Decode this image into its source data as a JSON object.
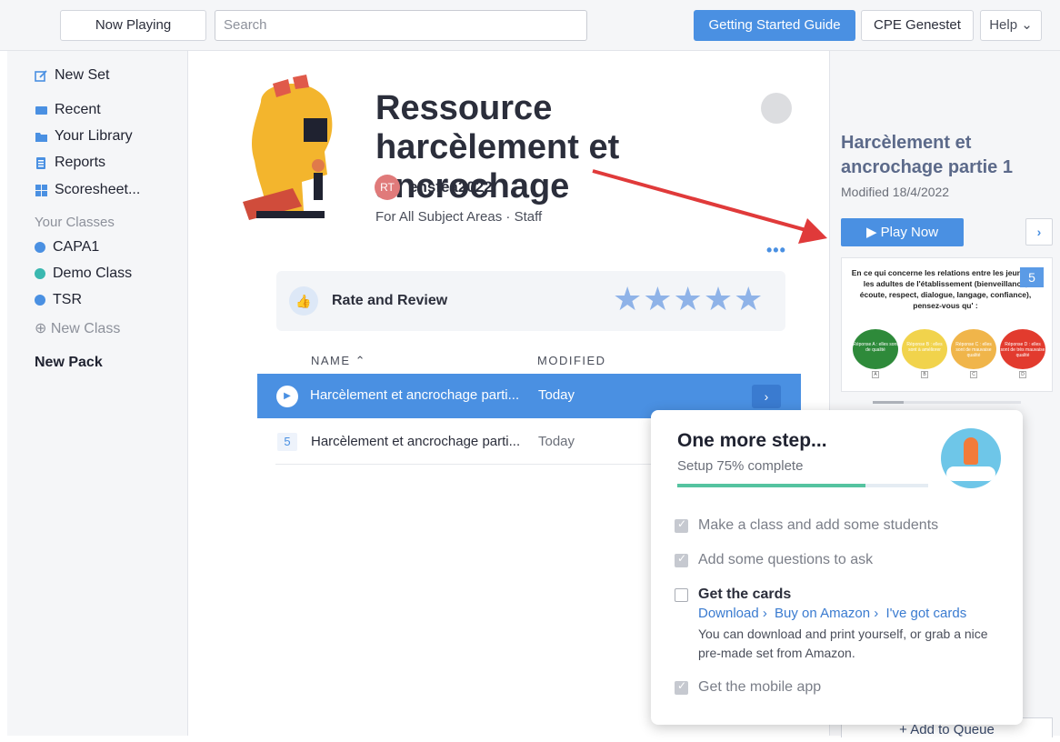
{
  "topbar": {
    "now_playing": "Now Playing",
    "search_placeholder": "Search",
    "guide": "Getting Started Guide",
    "account": "CPE Genestet",
    "help": "Help ⌄"
  },
  "sidebar": {
    "items": [
      {
        "label": "New Set",
        "icon": "edit-icon",
        "color": "#4a90e2"
      },
      {
        "label": "Recent",
        "icon": "recent-icon",
        "color": "#4a90e2"
      },
      {
        "label": "Your Library",
        "icon": "folder-icon",
        "color": "#4a90e2"
      },
      {
        "label": "Reports",
        "icon": "reports-icon",
        "color": "#4a90e2"
      },
      {
        "label": "Scoresheet...",
        "icon": "grid-icon",
        "color": "#4a90e2"
      }
    ],
    "classes_heading": "Your Classes",
    "classes": [
      {
        "label": "CAPA1",
        "color": "#4a90e2"
      },
      {
        "label": "Demo Class",
        "color": "#3ab8b0"
      },
      {
        "label": "TSR",
        "color": "#4a90e2"
      }
    ],
    "new_class": "⊕ New Class",
    "new_pack": "New Pack"
  },
  "main": {
    "title": "Ressource harcèlement et ancrochage",
    "avatar_initials": "RT",
    "username": "ensfea2022",
    "subject": "For All Subject Areas · Staff",
    "more": "•••",
    "rate_label": "Rate and Review",
    "stars": "★★★★★",
    "col_name": "NAME ⌃",
    "col_modified": "MODIFIED",
    "rows": [
      {
        "name": "Harcèlement et ancrochage parti...",
        "modified": "Today"
      },
      {
        "number": "5",
        "name": "Harcèlement et ancrochage parti...",
        "modified": "Today"
      }
    ]
  },
  "right_panel": {
    "title": "Harcèlement et ancrochage partie 1",
    "modified": "Modified 18/4/2022",
    "play_now": "▶ Play Now",
    "question_text": "En ce qui concerne les relations entre les jeunes et les adultes de l'établissement (bienveillance, écoute, respect, dialogue, langage, confiance), pensez-vous qu' :",
    "question_count": "5",
    "answers": [
      {
        "text": "Réponse A : elles sont de qualité",
        "letter": "A",
        "color": "#2e8a3a"
      },
      {
        "text": "Réponse B : elles sont à améliorer",
        "letter": "B",
        "color": "#f1d34c"
      },
      {
        "text": "Réponse C : elles sont de mauvaise qualité",
        "letter": "C",
        "color": "#f0b54a"
      },
      {
        "text": "Réponse D : elles sont de très mauvaise qualité",
        "letter": "D",
        "color": "#e23b2e"
      }
    ],
    "add_to_queue": "+ Add to Queue"
  },
  "setup_modal": {
    "title": "One more step...",
    "subtitle": "Setup 75% complete",
    "progress": 0.75,
    "tasks": [
      {
        "label": "Make a class and add some students",
        "done": true
      },
      {
        "label": "Add some questions to ask",
        "done": true
      },
      {
        "label": "Get the cards",
        "done": false
      },
      {
        "label": "Get the mobile app",
        "done": true
      }
    ],
    "links": [
      "Download ›",
      "Buy on Amazon ›",
      "I've got cards"
    ],
    "cards_description": "You can download and print yourself, or grab a nice pre-made set from Amazon."
  }
}
